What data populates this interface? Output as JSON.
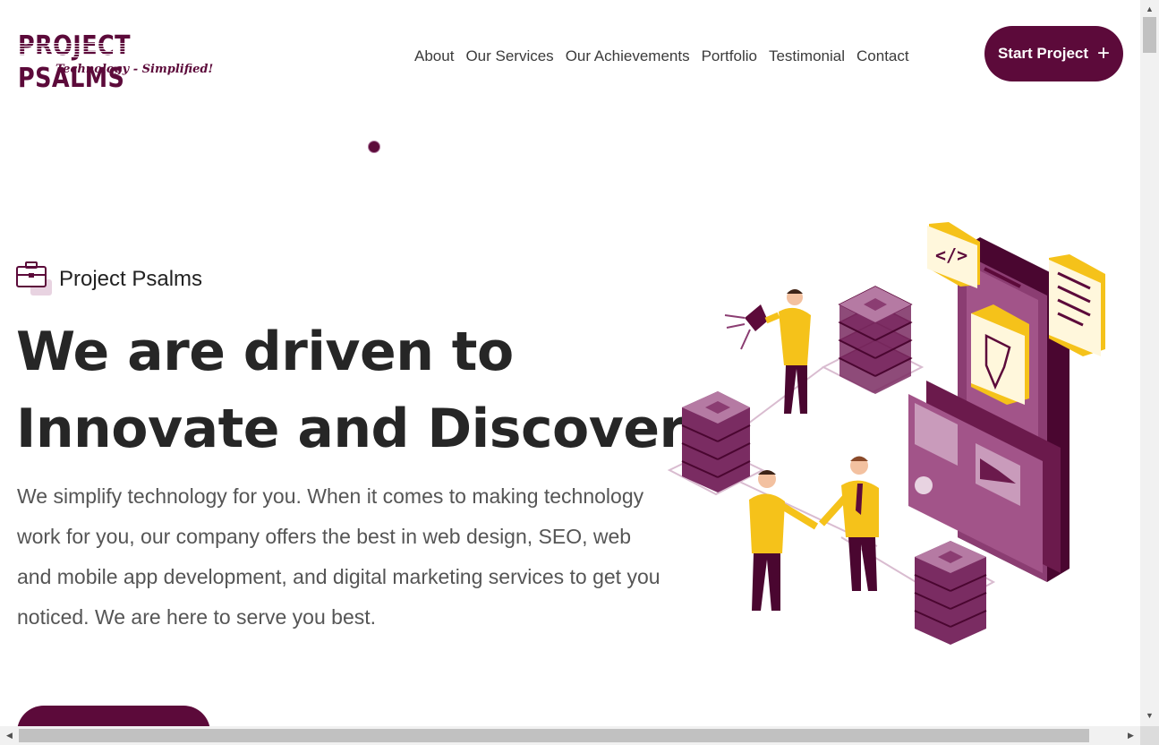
{
  "header": {
    "logo_title": "PROJECT PSALMS",
    "logo_tagline": "Technology - Simplified!",
    "nav": [
      "About",
      "Our Services",
      "Our Achievements",
      "Portfolio",
      "Testimonial",
      "Contact"
    ],
    "cta_label": "Start Project",
    "cta_icon": "plus-icon"
  },
  "hero": {
    "eyebrow_icon": "briefcase-icon",
    "eyebrow": "Project Psalms",
    "headline_line1": "We are driven to",
    "headline_line2": "Innovate and Discover.",
    "description": "We simplify technology for you. When it comes to making technology work for you, our company offers the best in web design, SEO, web and mobile app development, and digital marketing services to get you noticed. We are here to serve you best."
  },
  "colors": {
    "brand": "#5c0a3a",
    "accent_yellow": "#f5c21a",
    "text_dark": "#262626",
    "text_body": "#555555"
  }
}
